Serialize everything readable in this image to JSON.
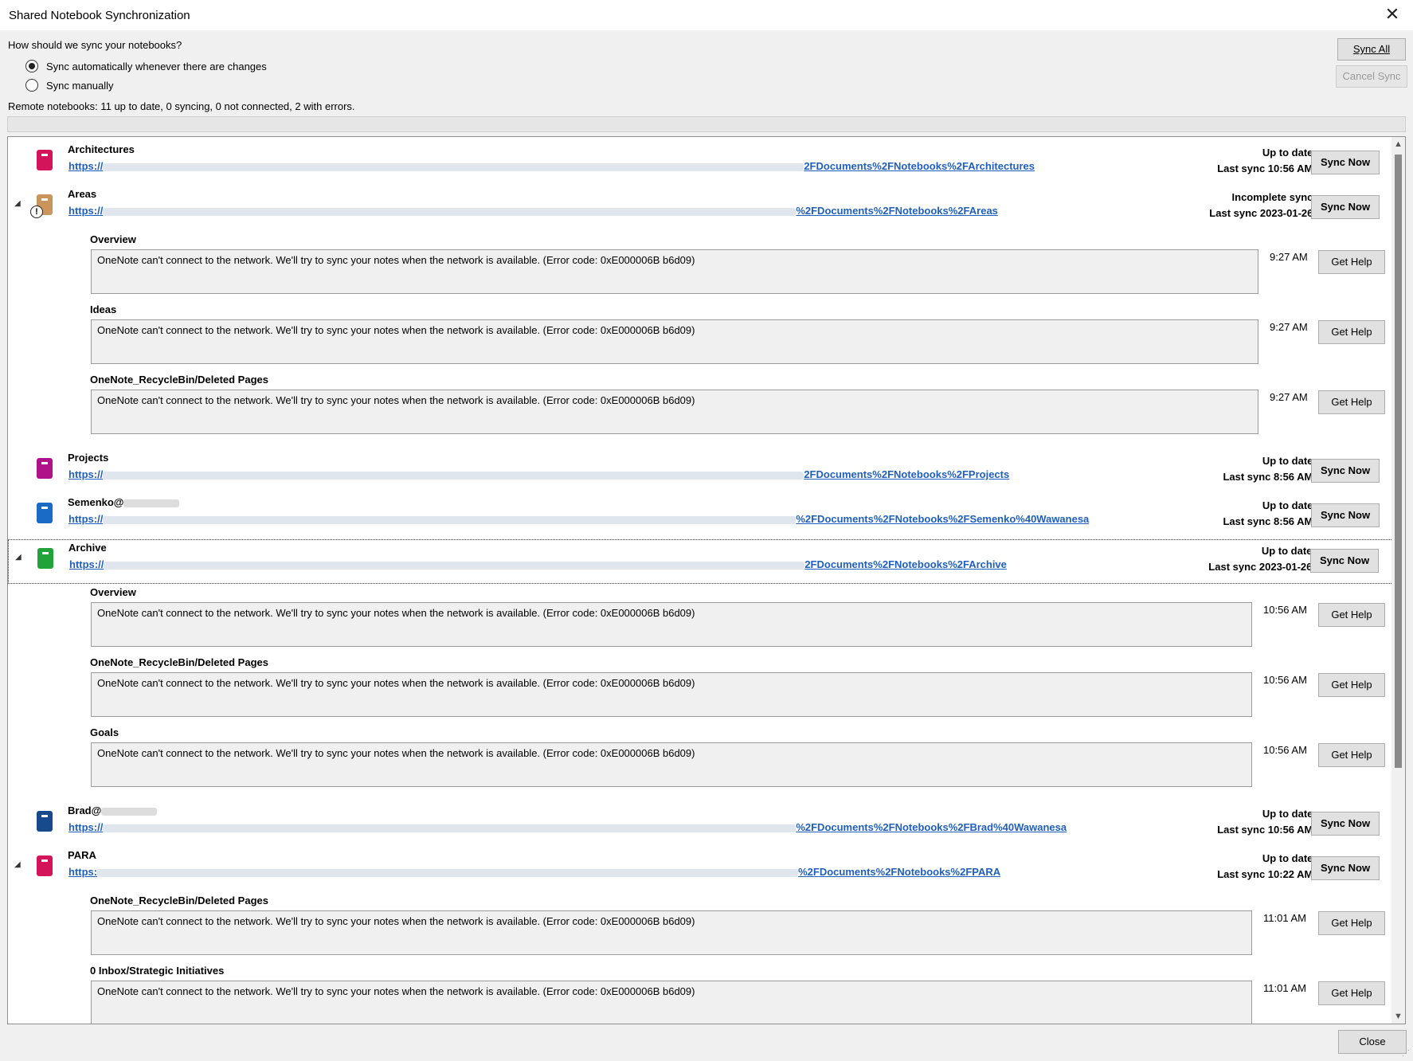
{
  "window": {
    "title": "Shared Notebook Synchronization",
    "close_glyph": "✕"
  },
  "settings": {
    "question": "How should we sync your notebooks?",
    "options": [
      {
        "label": "Sync automatically whenever there are changes",
        "selected": true
      },
      {
        "label": "Sync manually",
        "selected": false
      }
    ],
    "status": "Remote notebooks: 11 up to date, 0 syncing, 0 not connected, 2 with errors."
  },
  "buttons": {
    "sync_all": "Sync All",
    "cancel_sync": "Cancel Sync",
    "close": "Close"
  },
  "colors": {
    "architectures": "#d4145a",
    "areas": "#c9955a",
    "projects": "#b0128a",
    "semenko": "#1a6bc4",
    "archive": "#22a33a",
    "brad": "#174a8c",
    "para": "#d4145a"
  },
  "notebooks": [
    {
      "name": "Architectures",
      "url_start": "https://",
      "url_end": "2FDocuments%2FNotebooks%2FArchitectures",
      "status": "Up to date.",
      "last_sync": "Last sync 10:56 AM.",
      "button": "Sync Now"
    },
    {
      "name": "Areas",
      "url_start": "https://",
      "url_end": "%2FDocuments%2FNotebooks%2FAreas",
      "status": "Incomplete sync.",
      "last_sync": "Last sync 2023-01-26.",
      "button": "Sync Now",
      "warning_glyph": "!",
      "expander": "◢",
      "sections": [
        {
          "title": "Overview",
          "error": "OneNote can't connect to the network. We'll try to sync your notes when the network is available. (Error code: 0xE000006B b6d09)",
          "time": "9:27 AM",
          "button": "Get Help"
        },
        {
          "title": "Ideas",
          "error": "OneNote can't connect to the network. We'll try to sync your notes when the network is available. (Error code: 0xE000006B b6d09)",
          "time": "9:27 AM",
          "button": "Get Help"
        },
        {
          "title": "OneNote_RecycleBin/Deleted Pages",
          "error": "OneNote can't connect to the network. We'll try to sync your notes when the network is available. (Error code: 0xE000006B b6d09)",
          "time": "9:27 AM",
          "button": "Get Help"
        }
      ]
    },
    {
      "name": "Projects",
      "url_start": "https://",
      "url_end": "2FDocuments%2FNotebooks%2FProjects",
      "status": "Up to date.",
      "last_sync": "Last sync 8:56 AM.",
      "button": "Sync Now"
    },
    {
      "name": "Semenko@",
      "url_start": "https://",
      "url_end": "%2FDocuments%2FNotebooks%2FSemenko%40Wawanesa",
      "status": "Up to date.",
      "last_sync": "Last sync 8:56 AM.",
      "button": "Sync Now"
    },
    {
      "name": "Archive",
      "url_start": "https://",
      "url_end": "2FDocuments%2FNotebooks%2FArchive",
      "status": "Up to date.",
      "last_sync": "Last sync 2023-01-26.",
      "button": "Sync Now",
      "expander": "◢",
      "sections": [
        {
          "title": "Overview",
          "error": "OneNote can't connect to the network. We'll try to sync your notes when the network is available. (Error code: 0xE000006B b6d09)",
          "time": "10:56 AM",
          "button": "Get Help"
        },
        {
          "title": "OneNote_RecycleBin/Deleted Pages",
          "error": "OneNote can't connect to the network. We'll try to sync your notes when the network is available. (Error code: 0xE000006B b6d09)",
          "time": "10:56 AM",
          "button": "Get Help"
        },
        {
          "title": "Goals",
          "error": "OneNote can't connect to the network. We'll try to sync your notes when the network is available. (Error code: 0xE000006B b6d09)",
          "time": "10:56 AM",
          "button": "Get Help"
        }
      ]
    },
    {
      "name": "Brad@",
      "url_start": "https://",
      "url_end": "%2FDocuments%2FNotebooks%2FBrad%40Wawanesa",
      "status": "Up to date.",
      "last_sync": "Last sync 10:56 AM.",
      "button": "Sync Now"
    },
    {
      "name": "PARA",
      "url_start": "https:",
      "url_end": "%2FDocuments%2FNotebooks%2FPARA",
      "status": "Up to date.",
      "last_sync": "Last sync 10:22 AM.",
      "button": "Sync Now",
      "expander": "◢",
      "sections": [
        {
          "title": "OneNote_RecycleBin/Deleted Pages",
          "error": "OneNote can't connect to the network. We'll try to sync your notes when the network is available. (Error code: 0xE000006B b6d09)",
          "time": "11:01 AM",
          "button": "Get Help"
        },
        {
          "title": "0 Inbox/Strategic Initiatives",
          "error": "OneNote can't connect to the network. We'll try to sync your notes when the network is available. (Error code: 0xE000006B b6d09)",
          "time": "11:01 AM",
          "button": "Get Help"
        }
      ]
    }
  ],
  "scrollbar": {
    "up_glyph": "▲",
    "down_glyph": "▼"
  },
  "grip_glyph": "⋰"
}
